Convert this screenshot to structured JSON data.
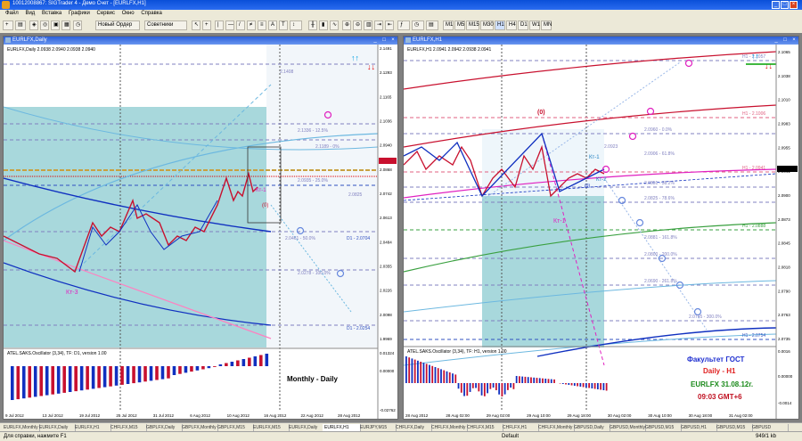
{
  "app": {
    "title": "10012008867: SIGTrader 4 - Демо Счет - [EURLFX,H1]"
  },
  "menu": [
    "Файл",
    "Вид",
    "Вставка",
    "Графики",
    "Сервис",
    "Окно",
    "Справка"
  ],
  "toolbar": {
    "new_order": "Новый Ордер",
    "advisors": "Советники",
    "timeframes": [
      "M1",
      "M5",
      "M15",
      "M30",
      "H1",
      "H4",
      "D1",
      "W1",
      "MN"
    ]
  },
  "left_window": {
    "title": "EURLFX,Daily",
    "info": "EURLFX,Daily 2.0938 2.0940 2.0938 2.0940",
    "osc_label": "ATEL.SAKS.Oscillator (3,34), TF: D1, version 1.00",
    "labels": {
      "kt3": "Кт-3",
      "kt1": "Кт-1",
      "zero": "(0)"
    },
    "right_label": "2.1408",
    "fib_labels": [
      "2.1336 - 12.5%",
      "2.1189 - 0%",
      "2.0935 - 25.0%",
      "2.0825",
      "D1 - 2.0704",
      "2.0461 - 50.0%",
      "2.0278 - 100.0%",
      "D1 - 2.0254"
    ],
    "price_axis": [
      "2.1491",
      "2.1293",
      "2.1165",
      "2.1036",
      "2.0940",
      "2.0868",
      "2.0742",
      "2.0613",
      "2.0484",
      "2.0355",
      "2.0226",
      "2.0098",
      "1.9969"
    ],
    "osc_axis": [
      "0.01324",
      "0.00000",
      "-0.02762"
    ],
    "dates": [
      "9 Jul 2012",
      "13 Jul 2012",
      "19 Jul 2012",
      "25 Jul 2012",
      "31 Jul 2012",
      "6 Aug 2012",
      "10 Aug 2012",
      "16 Aug 2012",
      "22 Aug 2012",
      "28 Aug 2012"
    ],
    "watermark": "Monthly - Daily"
  },
  "right_window": {
    "title": "EURLFX,H1",
    "info": "EURLFX,H1 2.0941 2.0942 2.0938 2.0941",
    "osc_label": "ATEL.SAKS.Oscillator (3,34), TF: H1, version 1.00",
    "labels": {
      "zero_top": "(0)",
      "kt1_left": "Кт-1",
      "kt1_right": "Кт-1",
      "kt2": "Кт-2",
      "zero_small": "(0)"
    },
    "fib_labels": [
      "H1 - 2.1057",
      "H1 - 2.1006",
      "2.0960 - 0.0%",
      "2.0923",
      "2.0906 - 61.8%",
      "H1 - 2.0941",
      "2.0851 - 38.2%",
      "2.0825 - 78.6%",
      "H1 - 2.0888",
      "2.0881 - 161.8%",
      "2.0800 - 200.0%",
      "2.0690 - 261.8%",
      "2.0745 - 300.0%",
      "H1 - 2.0754"
    ],
    "price_axis": [
      "2.1065",
      "2.1038",
      "2.1010",
      "2.0983",
      "2.0955",
      "2.0941",
      "2.0900",
      "2.0873",
      "2.0845",
      "2.0818",
      "2.0790",
      "2.0763",
      "2.0735"
    ],
    "osc_axis": [
      "0.0016",
      "0.00000",
      "-0.0014"
    ],
    "dates": [
      "28 Aug 2012",
      "28 Aug 02:00",
      "29 Aug 02:00",
      "29 Aug 10:00",
      "29 Aug 18:00",
      "30 Aug 02:00",
      "30 Aug 10:00",
      "30 Aug 18:00",
      "31 Aug 02:00"
    ],
    "info_box": {
      "line1": "Факультет ГОСТ",
      "line2": "Daily - H1",
      "line3": "EURLFX 31.08.12г.",
      "line4": "09:03 GMT+6"
    }
  },
  "bottom_tabs": [
    "EURLFX,Monthly",
    "EURLFX,Daily",
    "EURLFX,H1",
    "CHFLFX,M15",
    "GBPLFX,Daily",
    "GBPLFX,Monthly",
    "GBPLFX,M15",
    "EURLFX,M15",
    "EURLFX,Daily",
    "EURLFX,H1",
    "EURJPY,M15",
    "CHFLFX,Daily",
    "CHFLFX,Monthly",
    "CHFLFX,M15",
    "CHFLFX,H1",
    "CHFLFX,Monthly",
    "GBPUSD,Daily",
    "GBPUSD,Monthly",
    "GBPUSD,M15",
    "GBPUSD,H1",
    "GBPUSD,M15",
    "GBPUSD"
  ],
  "status": {
    "help": "Для справки, нажмите F1",
    "profile": "Default",
    "traffic": "949/1 kb"
  },
  "colors": {
    "bg_fill": "#a8d8dc",
    "fib_line": "#8080c0",
    "zigzag": "#c8102e",
    "blue_line": "#1030c0",
    "magenta": "#e020c0"
  }
}
